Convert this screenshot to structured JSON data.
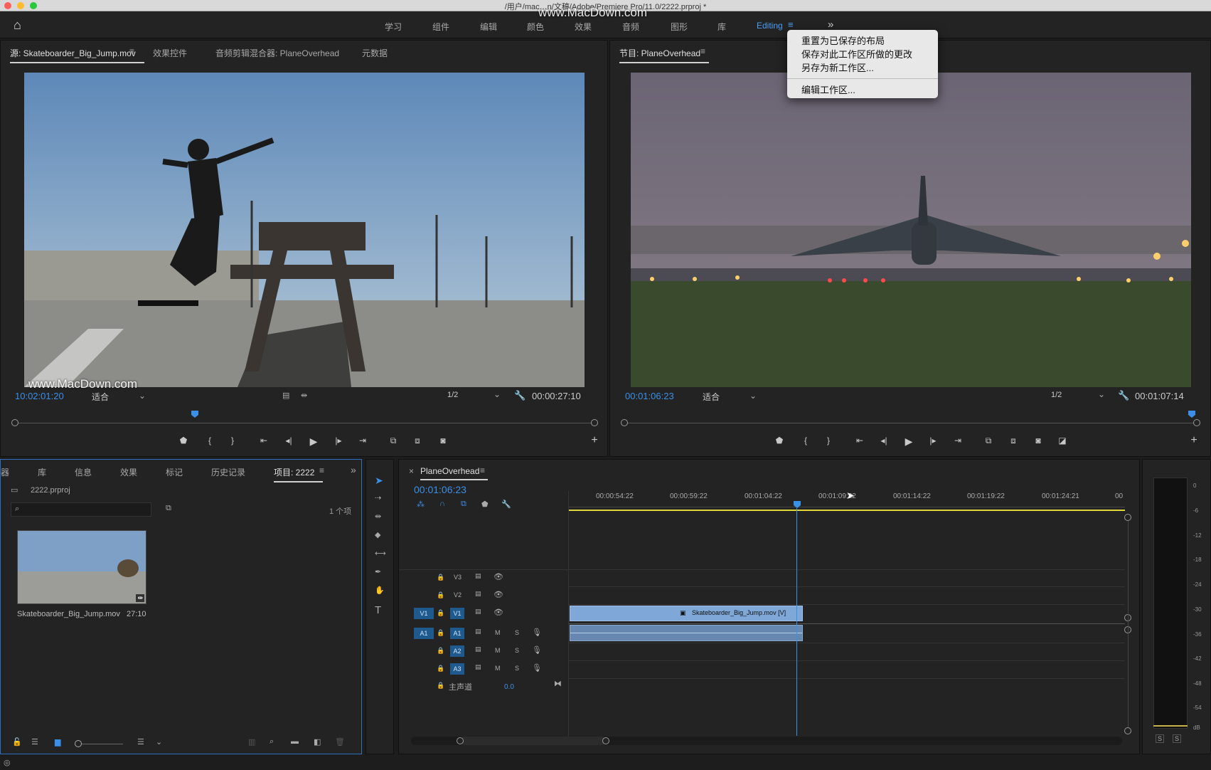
{
  "window": {
    "title": "/用户/mac…n/文稿/Adobe/Premiere Pro/11.0/2222.prproj *"
  },
  "watermark": "www.MacDown.com",
  "workspaces": [
    "学习",
    "组件",
    "编辑",
    "颜色",
    "效果",
    "音频",
    "图形",
    "库",
    "Editing"
  ],
  "workspace_menu": {
    "items": [
      "重置为已保存的布局",
      "保存对此工作区所做的更改",
      "另存为新工作区...",
      "编辑工作区..."
    ]
  },
  "source": {
    "tabs": [
      "源: Skateboarder_Big_Jump.mov",
      "效果控件",
      "音频剪辑混合器: PlaneOverhead",
      "元数据"
    ],
    "timecode": "10:02:01:20",
    "fit": "适合",
    "resolution": "1/2",
    "duration": "00:00:27:10"
  },
  "program": {
    "tab": "节目: PlaneOverhead",
    "timecode": "00:01:06:23",
    "fit": "适合",
    "resolution": "1/2",
    "duration": "00:01:07:14"
  },
  "project": {
    "tabs": [
      "器",
      "库",
      "信息",
      "效果",
      "标记",
      "历史记录",
      "项目: 2222"
    ],
    "file": "2222.prproj",
    "count": "1 个项",
    "clip_name": "Skateboarder_Big_Jump.mov",
    "clip_duration": "27:10"
  },
  "timeline": {
    "tab": "PlaneOverhead",
    "timecode": "00:01:06:23",
    "ruler": [
      "00:00:54:22",
      "00:00:59:22",
      "00:01:04:22",
      "00:01:09:22",
      "00:01:14:22",
      "00:01:19:22",
      "00:01:24:21",
      "00"
    ],
    "video_tracks": [
      "V3",
      "V2",
      "V1"
    ],
    "audio_tracks": [
      "A1",
      "A2",
      "A3"
    ],
    "src_v": "V1",
    "src_a": "A1",
    "master": "主声道",
    "master_val": "0.0",
    "clip_label": "Skateboarder_Big_Jump.mov [V]",
    "ms": [
      "M",
      "S"
    ]
  },
  "meter": {
    "scale": [
      "0",
      "-6",
      "-12",
      "-18",
      "-24",
      "-30",
      "-36",
      "-42",
      "-48",
      "-54",
      "dB"
    ],
    "solo": [
      "S",
      "S"
    ]
  },
  "colors": {
    "accent": "#3a8fe6",
    "clip_video": "#7fa7d8",
    "playhead": "#3a8fe6"
  }
}
